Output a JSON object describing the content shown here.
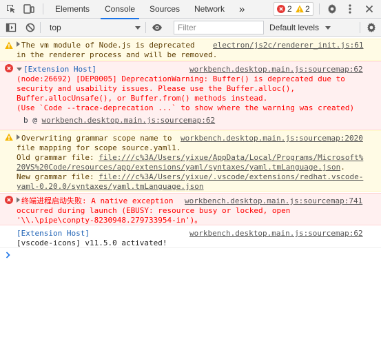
{
  "tabs": [
    {
      "label": "Elements"
    },
    {
      "label": "Console"
    },
    {
      "label": "Sources"
    },
    {
      "label": "Network"
    }
  ],
  "more_tabs_label": "»",
  "error_count": "2",
  "warning_count": "2",
  "toolbar": {
    "context": "top",
    "filter_placeholder": "Filter",
    "levels_label": "Default levels"
  },
  "messages": {
    "m1": {
      "text1": "The vm module of Node.js is deprecated",
      "source": "electron/js2c/renderer_init.js:61",
      "text2": "in the renderer process and will be removed."
    },
    "m2": {
      "header": "[Extension Host]",
      "source": "workbench.desktop.main.js:sourcemap:62",
      "lines": [
        "(node:26692) [DEP0005] DeprecationWarning: Buffer() is deprecated due to",
        "security and usability issues. Please use the Buffer.alloc(),",
        "Buffer.allocUnsafe(), or Buffer.from() methods instead.",
        "(Use `Code --trace-deprecation ...` to show where the warning was created)"
      ],
      "stack_prefix": "b @ ",
      "stack_link": "workbench.desktop.main.js:sourcemap:62"
    },
    "m3": {
      "line1": "Overwriting grammar scope name to",
      "source": "workbench.desktop.main.js:sourcemap:2020",
      "line2": "file mapping for scope source.yaml1.",
      "old_label": "Old grammar file: ",
      "old_link1": "file:///c%3A/Users/yixue/AppData/Local/Programs/Microsoft%",
      "old_link2": "20VS%20Code/resources/app/extensions/yaml/syntaxes/yaml.tmLanguage.json",
      "old_tail": ".",
      "new_label": "New grammar file: ",
      "new_link1": "file:///c%3A/Users/yixue/.vscode/extensions/redhat.vscode-",
      "new_link2": "yaml-0.20.0/syntaxes/yaml.tmLanguage.json"
    },
    "m4": {
      "line1": "终端进程启动失败: A native exception",
      "source": "workbench.desktop.main.js:sourcemap:741",
      "line2": "occurred during launch (EBUSY: resource busy or locked, open",
      "line3": "'\\\\.\\pipe\\conpty-8230948.279733954-in')。"
    },
    "m5": {
      "header": "[Extension Host]",
      "source": "workbench.desktop.main.js:sourcemap:62",
      "line2": "[vscode-icons] v11.5.0 activated!"
    }
  },
  "colors": {
    "accent": "#1a73e8",
    "error": "#f00",
    "warning_bg": "#fffbe5",
    "error_bg": "#fff0f0"
  }
}
